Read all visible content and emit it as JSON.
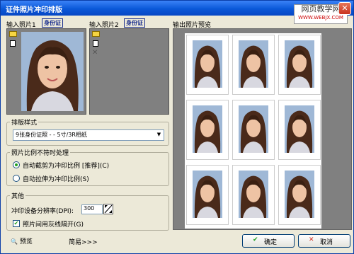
{
  "window": {
    "title": "证件照片冲印排版",
    "close_glyph": "✕"
  },
  "watermark": {
    "line1": "网页教学网",
    "line2": "WWW.WEBJX.COM"
  },
  "input1": {
    "label": "输入照片1",
    "tag": "身份证"
  },
  "input2": {
    "label": "输入照片2",
    "tag": "身份证"
  },
  "output": {
    "label": "输出照片预览"
  },
  "layout": {
    "title": "排版样式",
    "combo_value": "9张身份证照     - -     5寸/3R相纸",
    "combo_arrow": "▼"
  },
  "ratio": {
    "title": "照片比例不符时处理",
    "option1": "自动截剪为冲印比例 [推荐](C)",
    "option2": "自动拉伸为冲印比例(S)",
    "selected": "option1"
  },
  "other": {
    "title": "其他",
    "dpi_label": "冲印设备分辨率(DPI):",
    "dpi_value": "300",
    "gray_label": "照片间用灰线隔开(G)",
    "gray_checked": true,
    "check_glyph": "✔"
  },
  "buttons": {
    "preview": "预览",
    "simple": "简易>>>",
    "ok": "确定",
    "cancel": "取消",
    "ok_glyph": "✔",
    "cancel_glyph": "✕",
    "preview_glyph": "🔍"
  },
  "preview": {
    "rows": 3,
    "cols": 3
  },
  "icons": [
    "folder-icon",
    "new-file-icon",
    "delete-icon",
    "close-icon",
    "search-icon",
    "check-icon",
    "cross-icon"
  ],
  "colors": {
    "title_bar": "#0a58d8",
    "window_bg": "#ece9d8",
    "photo_bg": "#808080",
    "tag_text": "#1b2f8f"
  }
}
